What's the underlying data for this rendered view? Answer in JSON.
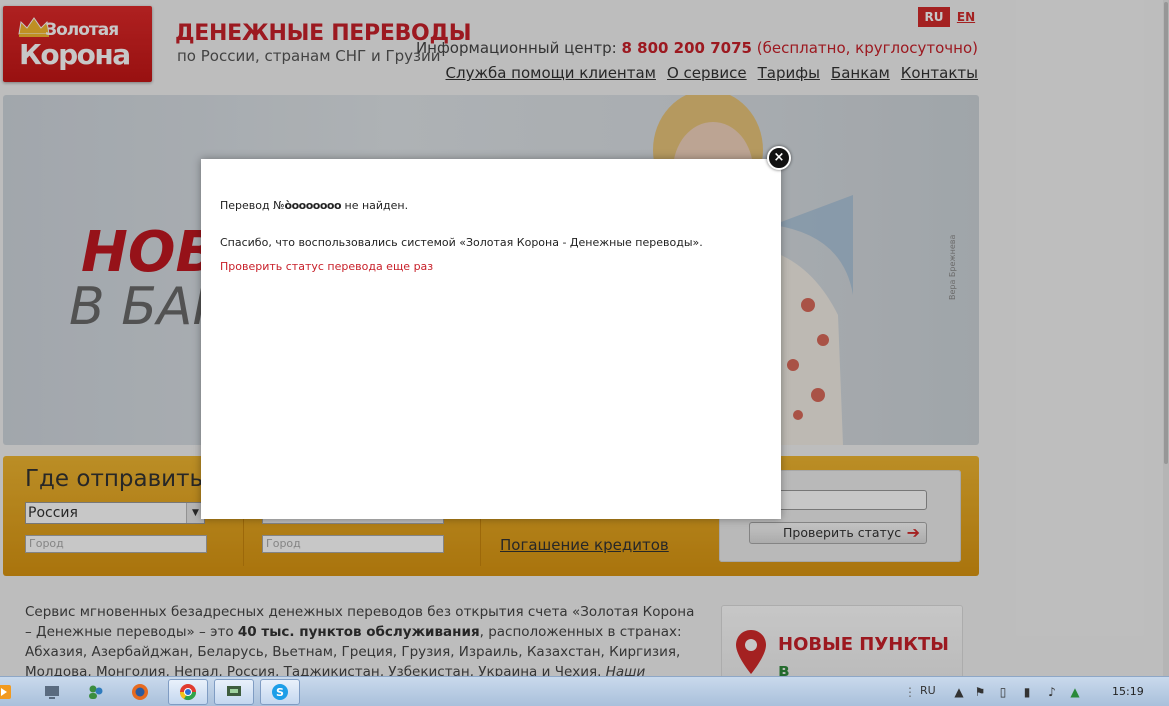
{
  "header": {
    "logo_top": "Золотая",
    "logo_bottom": "Корона",
    "tagline_title": "ДЕНЕЖНЫЕ ПЕРЕВОДЫ",
    "tagline_sub": "по России, странам СНГ и Грузии",
    "lang_ru": "RU",
    "lang_en": "EN",
    "info_label": "Информационный центр:",
    "info_phone": "8 800 200 7075",
    "info_note": "(бесплатно, круглосуточно)",
    "nav": [
      "Служба помощи клиентам",
      "О сервисе",
      "Тарифы",
      "Банкам",
      "Контакты"
    ]
  },
  "banner": {
    "title_1": "НОВ",
    "title_2": "В БАН",
    "credit": "Вера Брежнева"
  },
  "panel": {
    "title": "Где отправить",
    "country_value": "Россия",
    "city_placeholder_1": "Город",
    "city_placeholder_2": "Город",
    "credit_link": "Погашение кредитов",
    "status_button": "Проверить статус"
  },
  "about": {
    "text_1": "Сервис мгновенных безадресных денежных переводов без открытия счета «Золотая Корона – Денежные переводы» – это ",
    "text_bold": "40 тыс. пунктов обслуживания",
    "text_2": ", расположенных в странах: Абхазия, Азербайджан, Беларусь, Вьетнам, Греция, Грузия, Израиль, Казахстан, Киргизия, Молдова, Монголия, Непал, Россия, Таджикистан, Узбекистан, Украина и Чехия. ",
    "text_italic": "Наши переводы – легкие, быстрые, верные!"
  },
  "promo": {
    "line_1": "НОВЫЕ ПУНКТЫ",
    "line_2": "в АЗЕРБАЙДЖАНЕ"
  },
  "modal": {
    "line1_prefix": "Перевод №",
    "transfer_number": "òooooooo",
    "line1_suffix": " не найден.",
    "thanks": "Спасибо, что воспользовались системой «Золотая Корона - Денежные переводы».",
    "retry_link": "Проверить статус перевода еще раз",
    "close_label": "×"
  },
  "taskbar": {
    "lang": "RU",
    "clock": "15:19"
  },
  "colors": {
    "brand_red": "#c8202a",
    "panel_orange": "#e3a11d",
    "accent_green": "#2f8a3b"
  }
}
